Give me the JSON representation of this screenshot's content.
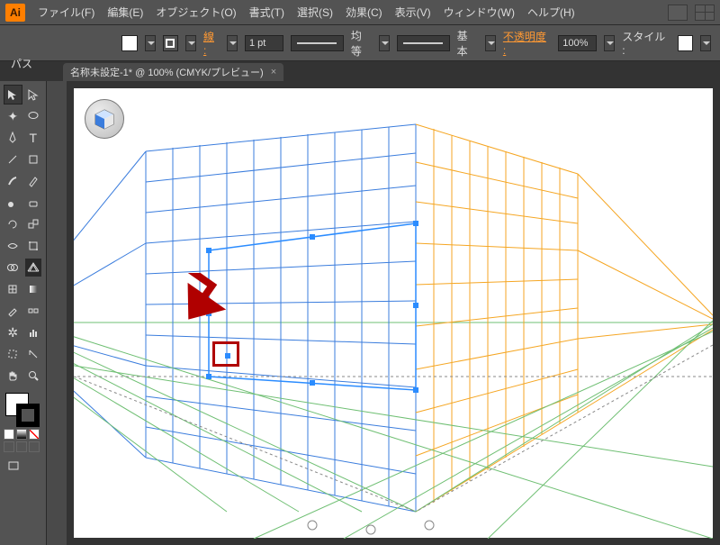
{
  "app": {
    "badge": "Ai"
  },
  "menu": {
    "items": [
      "ファイル(F)",
      "編集(E)",
      "オブジェクト(O)",
      "書式(T)",
      "選択(S)",
      "効果(C)",
      "表示(V)",
      "ウィンドウ(W)",
      "ヘルプ(H)"
    ]
  },
  "control": {
    "path_label": "パス",
    "stroke_label": "線 :",
    "stroke_width": "1 pt",
    "cap_label": "均等",
    "profile_label": "基本",
    "opacity_label": "不透明度 :",
    "opacity_value": "100%",
    "style_label": "スタイル :"
  },
  "document": {
    "tab_title": "名称未設定-1* @ 100% (CMYK/プレビュー)",
    "close_glyph": "×"
  },
  "tools": {
    "rows": [
      [
        "selection",
        "direct-selection"
      ],
      [
        "magic-wand",
        "lasso"
      ],
      [
        "pen",
        "type"
      ],
      [
        "line",
        "rectangle"
      ],
      [
        "paintbrush",
        "pencil"
      ],
      [
        "blob-brush",
        "eraser"
      ],
      [
        "rotate",
        "scale"
      ],
      [
        "width",
        "free-transform"
      ],
      [
        "shape-builder",
        "perspective-grid"
      ],
      [
        "mesh",
        "gradient"
      ],
      [
        "eyedropper",
        "blend"
      ],
      [
        "symbol-sprayer",
        "column-graph"
      ],
      [
        "artboard",
        "slice"
      ],
      [
        "hand",
        "zoom"
      ]
    ],
    "highlighted": "perspective-grid"
  },
  "annotation": {
    "arrow_color": "#b00000",
    "box_color": "#b00000"
  },
  "perspective": {
    "left_grid_color": "#3b7ddd",
    "right_grid_color": "#f5a623",
    "floor_grid_color": "#6fbf73",
    "selection_color": "#2b8cff"
  }
}
